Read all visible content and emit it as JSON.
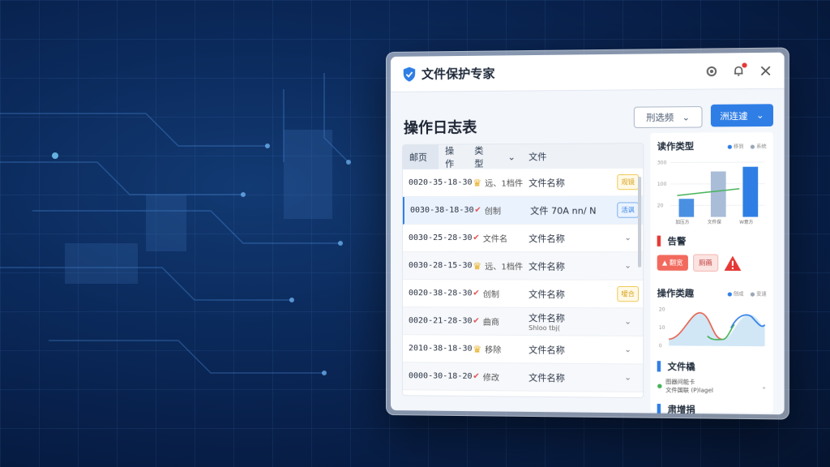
{
  "app": {
    "title": "文件保护专家",
    "page_title": "操作日志表",
    "filter_label": "刑选频",
    "action_label": "洲连遽"
  },
  "table": {
    "headers": [
      "邮页",
      "操作",
      "类型",
      "文件"
    ],
    "rows": [
      {
        "time": "0020-35-18-30",
        "op": "远、1档件",
        "file": "文件名称",
        "file_sub": "",
        "tag": "观镜",
        "tag_type": "warn",
        "selected": false
      },
      {
        "time": "0030-38-18-30",
        "op": "创制",
        "file": "文件 70A nn/ N",
        "file_sub": "",
        "tag": "活讽",
        "tag_type": "info",
        "selected": true
      },
      {
        "time": "0030-25-28-30",
        "op": "文件名",
        "file": "文件名称",
        "file_sub": "",
        "tag": "",
        "tag_type": "chev",
        "selected": false
      },
      {
        "time": "0030-28-15-30",
        "op": "远、1档件",
        "file": "文件名称",
        "file_sub": "",
        "tag": "",
        "tag_type": "chev",
        "selected": false
      },
      {
        "time": "0020-38-28-30",
        "op": "创制",
        "file": "文件名称",
        "file_sub": "",
        "tag": "嗳合",
        "tag_type": "warn",
        "selected": false
      },
      {
        "time": "0020-21-28-30",
        "op": "曲商",
        "file": "文件名称",
        "file_sub": "Shloo tbj(",
        "tag": "",
        "tag_type": "chev",
        "selected": false
      },
      {
        "time": "2010-38-18-30",
        "op": "移除",
        "file": "文件名称",
        "file_sub": "",
        "tag": "",
        "tag_type": "chev",
        "selected": false
      },
      {
        "time": "0000-30-18-20",
        "op": "修改",
        "file": "文件名称",
        "file_sub": "",
        "tag": "",
        "tag_type": "chev",
        "selected": false
      }
    ]
  },
  "side": {
    "chart1_title": "读作类型",
    "chart1_legend": [
      "移到",
      "系统"
    ],
    "chart1_yticks": [
      "300",
      "100",
      "20"
    ],
    "chart1_xlabels": [
      "加压方",
      "文件保",
      "W意方"
    ],
    "chart1_values": [
      60,
      150,
      165
    ],
    "alert_title": "告警",
    "alert_tags": [
      "翻宽",
      "厕画"
    ],
    "chart2_title": "操作类趣",
    "chart2_legend": [
      "刨成",
      "变速"
    ],
    "chart2_yticks": [
      "20",
      "10",
      "0"
    ],
    "file_title": "文件橇",
    "file_lines": [
      "图器间能卡",
      "文件国联 (P)lagel"
    ],
    "bottom_title": "肃增捐"
  }
}
